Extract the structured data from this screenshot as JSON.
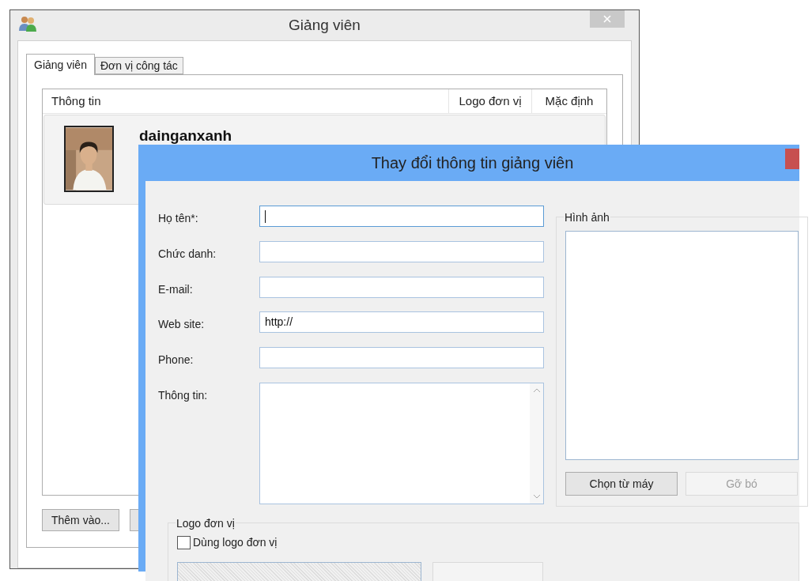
{
  "main_window": {
    "title": "Giảng viên",
    "tabs": [
      {
        "label": "Giảng viên",
        "selected": true
      },
      {
        "label": "Đơn vị công tác",
        "selected": false
      }
    ],
    "list": {
      "columns": [
        "Thông tin",
        "Logo đơn vị",
        "Mặc định"
      ],
      "rows": [
        {
          "kind": "picture",
          "name": "dainganxanh",
          "selected": true
        }
      ]
    },
    "buttons": [
      "Thêm vào..."
    ]
  },
  "dialog": {
    "title": "Thay đổi thông tin giảng viên",
    "fields": [
      {
        "label": "Họ tên*:",
        "focused": true,
        "kind": "text"
      },
      {
        "label": "Chức danh:",
        "focused": false,
        "kind": "text"
      },
      {
        "label": "E-mail:",
        "focused": false,
        "kind": "text"
      },
      {
        "label": "Web site:",
        "value": "http://",
        "focused": false,
        "kind": "text"
      },
      {
        "label": "Phone:",
        "focused": false,
        "kind": "text"
      },
      {
        "label": "Thông tin:",
        "focused": false,
        "kind": "multiline"
      }
    ],
    "image_group": {
      "title": "Hình ảnh",
      "buttons": [
        {
          "label": "Chọn từ máy",
          "disabled": false
        },
        {
          "label": "Gỡ bó",
          "disabled": true
        }
      ]
    },
    "logo_group": {
      "title": "Logo đơn vị",
      "checkbox": {
        "label": "Dùng logo đơn vị",
        "checked": false
      }
    }
  }
}
